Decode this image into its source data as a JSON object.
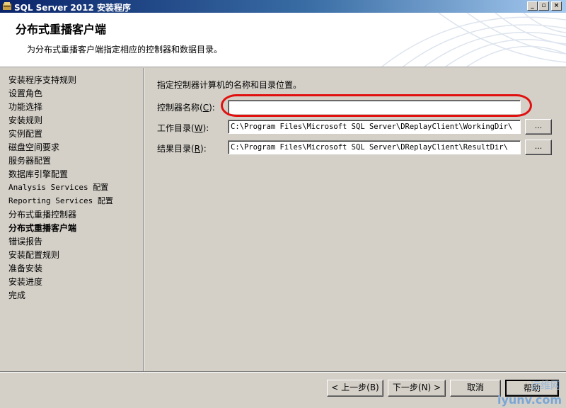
{
  "window": {
    "title": "SQL Server 2012 安装程序",
    "controls": [
      "minimize",
      "maximize",
      "close"
    ]
  },
  "header": {
    "title": "分布式重播客户端",
    "subtitle": "为分布式重播客户端指定相应的控制器和数据目录。"
  },
  "sidebar": {
    "items": [
      {
        "label": "安装程序支持规则",
        "active": false
      },
      {
        "label": "设置角色",
        "active": false
      },
      {
        "label": "功能选择",
        "active": false
      },
      {
        "label": "安装规则",
        "active": false
      },
      {
        "label": "实例配置",
        "active": false
      },
      {
        "label": "磁盘空间要求",
        "active": false
      },
      {
        "label": "服务器配置",
        "active": false
      },
      {
        "label": "数据库引擎配置",
        "active": false
      },
      {
        "label": "Analysis Services 配置",
        "active": false
      },
      {
        "label": "Reporting Services 配置",
        "active": false
      },
      {
        "label": "分布式重播控制器",
        "active": false
      },
      {
        "label": "分布式重播客户端",
        "active": true
      },
      {
        "label": "错误报告",
        "active": false
      },
      {
        "label": "安装配置规则",
        "active": false
      },
      {
        "label": "准备安装",
        "active": false
      },
      {
        "label": "安装进度",
        "active": false
      },
      {
        "label": "完成",
        "active": false
      }
    ]
  },
  "main": {
    "intro": "指定控制器计算机的名称和目录位置。",
    "controller_name": {
      "label_pre": "控制器名称(",
      "hotkey": "C",
      "label_post": "):",
      "value": ""
    },
    "working_dir": {
      "label_pre": "工作目录(",
      "hotkey": "W",
      "label_post": "):",
      "value": "C:\\Program Files\\Microsoft SQL Server\\DReplayClient\\WorkingDir\\"
    },
    "result_dir": {
      "label_pre": "结果目录(",
      "hotkey": "R",
      "label_post": "):",
      "value": "C:\\Program Files\\Microsoft SQL Server\\DReplayClient\\ResultDir\\"
    },
    "browse_label": "..."
  },
  "footer": {
    "back": "< 上一步(B)",
    "next": "下一步(N) >",
    "cancel": "取消",
    "help": "帮助"
  },
  "watermark": {
    "line1": "运维网",
    "line2": "iyunv.com"
  },
  "colors": {
    "highlight": "#e01010",
    "titlebar_start": "#0a246a",
    "titlebar_end": "#a6caf0"
  }
}
